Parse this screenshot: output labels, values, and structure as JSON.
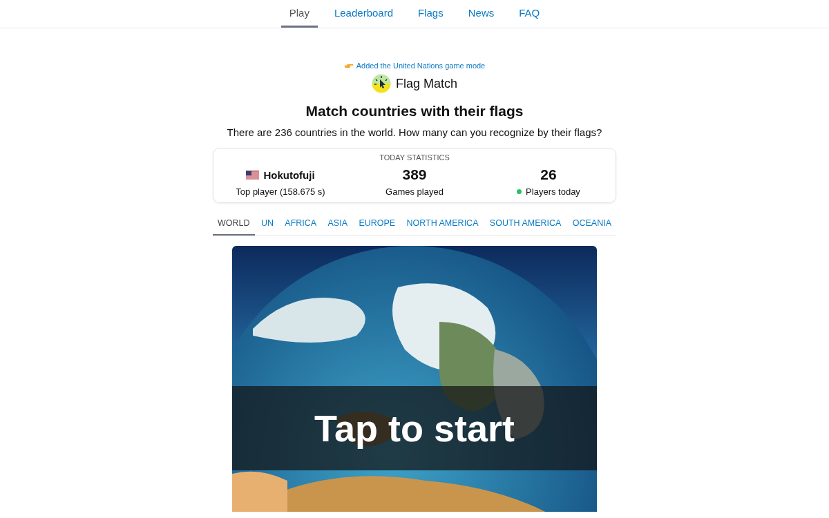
{
  "nav": [
    {
      "label": "Play",
      "selected": true
    },
    {
      "label": "Leaderboard",
      "selected": false
    },
    {
      "label": "Flags",
      "selected": false
    },
    {
      "label": "News",
      "selected": false
    },
    {
      "label": "FAQ",
      "selected": false
    }
  ],
  "announcement": "Added the United Nations game mode",
  "app_name": "Flag Match",
  "heading": "Match countries with their flags",
  "subheading": "There are 236 countries in the world. How many can you recognize by their flags?",
  "stats": {
    "title": "TODAY STATISTICS",
    "top_player": {
      "name": "Hokutofuji",
      "label": "Top player (158.675 s)"
    },
    "games": {
      "value": "389",
      "label": "Games played"
    },
    "players": {
      "value": "26",
      "label": "Players today",
      "color": "#22c55e"
    }
  },
  "regions": [
    {
      "label": "WORLD",
      "selected": true
    },
    {
      "label": "UN",
      "selected": false
    },
    {
      "label": "AFRICA",
      "selected": false
    },
    {
      "label": "ASIA",
      "selected": false
    },
    {
      "label": "EUROPE",
      "selected": false
    },
    {
      "label": "NORTH AMERICA",
      "selected": false
    },
    {
      "label": "SOUTH AMERICA",
      "selected": false
    },
    {
      "label": "OCEANIA",
      "selected": false
    }
  ],
  "start": {
    "kind": "picture",
    "label": "Tap to start"
  }
}
